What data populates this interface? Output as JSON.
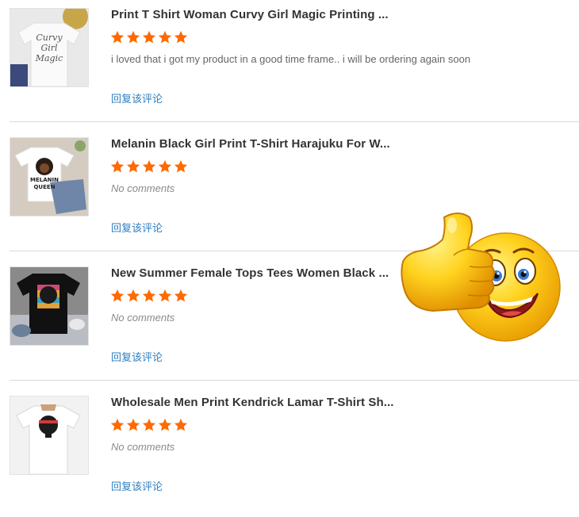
{
  "reviews": [
    {
      "title": "Print T Shirt Woman Curvy Girl Magic Printing ...",
      "rating": 5,
      "comment": "i loved that i got my product in a good time frame.. i will be ordering again soon",
      "reply_label": "回复该评论",
      "thumb_text": [
        "Curvy",
        "Girl",
        "Magic"
      ]
    },
    {
      "title": "Melanin Black Girl Print T-Shirt Harajuku For W...",
      "rating": 5,
      "comment": "No comments",
      "reply_label": "回复该评论",
      "thumb_text": [
        "MELANIN",
        "QUEEN"
      ]
    },
    {
      "title": "New Summer Female Tops Tees Women Black ...",
      "rating": 5,
      "comment": "No comments",
      "reply_label": "回复该评论"
    },
    {
      "title": "Wholesale Men Print Kendrick Lamar T-Shirt Sh...",
      "rating": 5,
      "comment": "No comments",
      "reply_label": "回复该评论"
    }
  ],
  "colors": {
    "star": "#ff6a00",
    "link": "#2f7fc1",
    "title": "#333333",
    "divider": "#d9d9d9"
  },
  "icons": {
    "star": "star-icon",
    "emoji": "thumbs-up-smiley-icon"
  }
}
